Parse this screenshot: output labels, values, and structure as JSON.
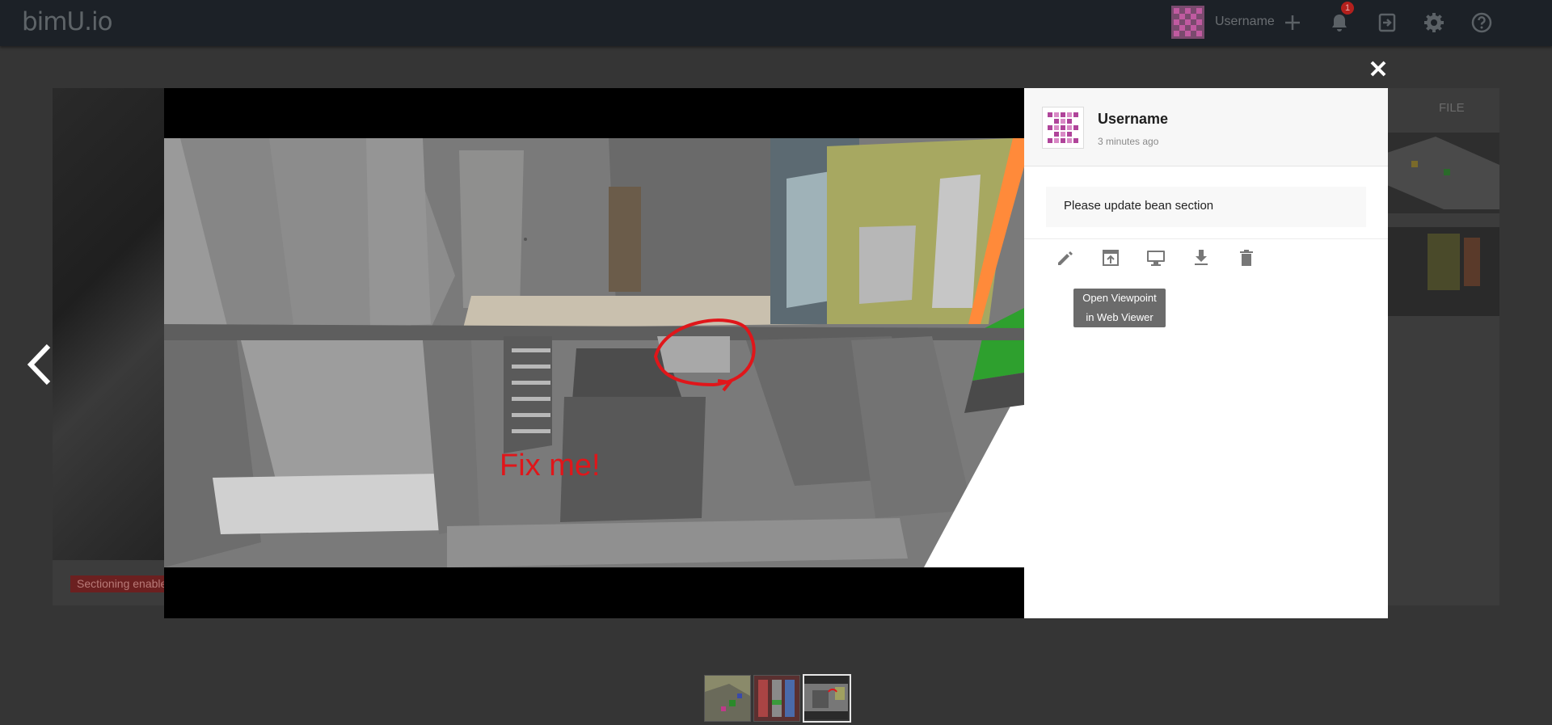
{
  "app": {
    "logo": "bimU.io"
  },
  "topbar": {
    "username": "Username",
    "notification_count": "1",
    "icons": [
      "plus-icon",
      "bell-icon",
      "logout-icon",
      "gear-icon",
      "help-icon"
    ]
  },
  "background": {
    "file_label": "FILE",
    "section_badge": "Sectioning enable"
  },
  "viewer": {
    "annotation_text": "Fix me!"
  },
  "comment": {
    "author": "Username",
    "time": "3 minutes ago",
    "text": "Please update bean section",
    "actions": [
      "pencil-icon",
      "open-viewpoint-icon",
      "monitor-icon",
      "download-icon",
      "trash-icon"
    ],
    "tooltip_line1": "Open Viewpoint",
    "tooltip_line2": "in Web Viewer"
  },
  "thumbnails": {
    "count": 3,
    "active_index": 2
  },
  "colors": {
    "topbar": "#1c2127",
    "overlay": "#353535",
    "badge": "#b3201d",
    "annotation": "#e0161a"
  }
}
